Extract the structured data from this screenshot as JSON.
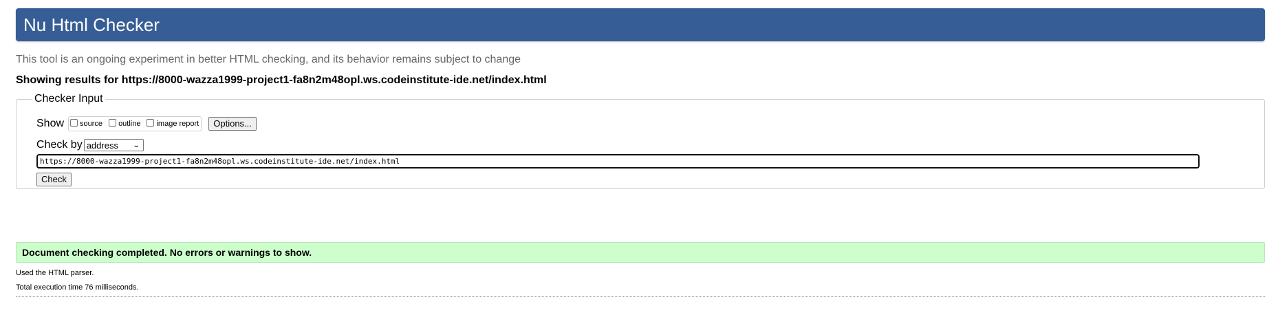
{
  "header": {
    "title": "Nu Html Checker"
  },
  "intro_text": "This tool is an ongoing experiment in better HTML checking, and its behavior remains subject to change",
  "results_for": "Showing results for https://8000-wazza1999-project1-fa8n2m48opl.ws.codeinstitute-ide.net/index.html",
  "checker_input": {
    "legend": "Checker Input",
    "show_label": "Show",
    "show_options": [
      {
        "label": "source",
        "checked": false
      },
      {
        "label": "outline",
        "checked": false
      },
      {
        "label": "image report",
        "checked": false
      }
    ],
    "options_button": "Options...",
    "check_by_label": "Check by",
    "check_by_selected": "address",
    "url_value": "https://8000-wazza1999-project1-fa8n2m48opl.ws.codeinstitute-ide.net/index.html",
    "check_button": "Check"
  },
  "result": {
    "message": "Document checking completed. No errors or warnings to show.",
    "parser_note": "Used the HTML parser.",
    "execution_time": "Total execution time 76 milliseconds."
  },
  "colors": {
    "header_bg": "#365d95",
    "success_bg": "#ccffcc"
  }
}
